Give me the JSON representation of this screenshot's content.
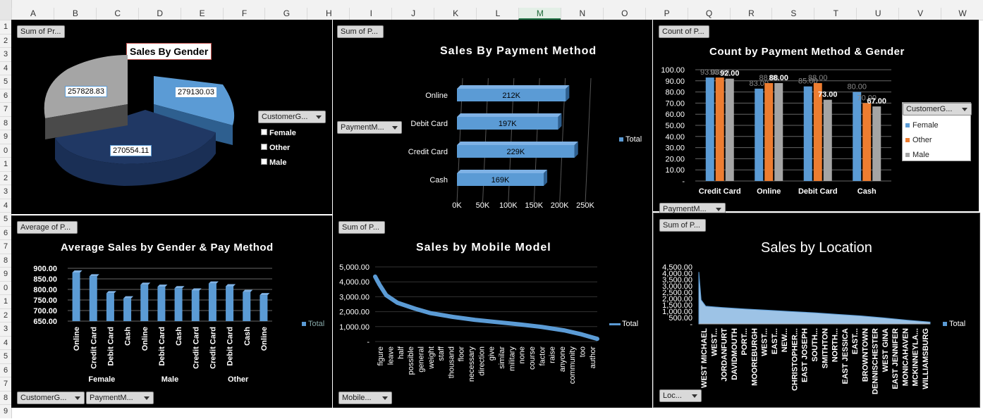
{
  "sheet": {
    "columns": [
      "A",
      "B",
      "C",
      "D",
      "E",
      "F",
      "G",
      "H",
      "I",
      "J",
      "K",
      "L",
      "M",
      "N",
      "O",
      "P",
      "Q",
      "R",
      "S",
      "T",
      "U",
      "V",
      "W"
    ],
    "selected_column": "M",
    "rows": [
      "1",
      "2",
      "3",
      "4",
      "5",
      "6",
      "7",
      "8",
      "9",
      "0",
      "1",
      "2",
      "3",
      "4",
      "5",
      "6",
      "7",
      "8",
      "9",
      "0",
      "1",
      "2",
      "3",
      "4",
      "5",
      "6",
      "7",
      "8",
      "9"
    ]
  },
  "panels": {
    "gender": {
      "title": "Sales By Gender",
      "field_button": "Sum of Pr...",
      "legend_button": "CustomerG...",
      "legend": [
        "Female",
        "Other",
        "Male"
      ],
      "colors": {
        "female": "#5b9bd5",
        "other": "#203864",
        "male": "#a5a5a5"
      }
    },
    "payment": {
      "title": "Sales By Payment Method",
      "field_button": "Sum of P...",
      "axis_button": "PaymentM...",
      "legend": "Total"
    },
    "count": {
      "title": "Count by Payment Method & Gender",
      "field_button": "Count of P...",
      "axis_button": "PaymentM...",
      "legend_button": "CustomerG...",
      "legend": [
        "Female",
        "Other",
        "Male"
      ]
    },
    "average": {
      "title": "Average Sales by Gender & Pay Method",
      "field_button": "Average of P...",
      "buttons": [
        "CustomerG...",
        "PaymentM..."
      ],
      "legend": "Total"
    },
    "mobile": {
      "title": "Sales by Mobile Model",
      "field_button": "Sum of P...",
      "axis_button": "Mobile...",
      "legend": "Total"
    },
    "location": {
      "title": "Sales by Location",
      "field_button": "Sum of P...",
      "axis_button": "Loc...",
      "legend": "Total"
    }
  },
  "chart_data": [
    {
      "type": "pie",
      "title": "Sales By Gender",
      "categories": [
        "Female",
        "Other",
        "Male"
      ],
      "values": [
        279130.03,
        270554.11,
        257828.83
      ],
      "value_labels": [
        "279130.03",
        "270554.11",
        "257828.83"
      ],
      "legend_placement": "right"
    },
    {
      "type": "bar",
      "orientation": "horizontal",
      "title": "Sales By Payment Method",
      "categories": [
        "Online",
        "Debit Card",
        "Credit Card",
        "Cash"
      ],
      "values": [
        212000,
        197000,
        229000,
        169000
      ],
      "value_labels": [
        "212K",
        "197K",
        "229K",
        "169K"
      ],
      "x_ticks": [
        "0K",
        "50K",
        "100K",
        "150K",
        "200K",
        "250K"
      ],
      "xlim": [
        0,
        250000
      ],
      "legend": [
        "Total"
      ],
      "legend_placement": "right"
    },
    {
      "type": "bar",
      "title": "Count by Payment Method & Gender",
      "categories": [
        "Credit Card",
        "Online",
        "Debit Card",
        "Cash"
      ],
      "series": [
        {
          "name": "Female",
          "values": [
            93,
            83,
            85,
            80
          ],
          "color": "#5b9bd5"
        },
        {
          "name": "Other",
          "values": [
            93,
            88,
            88,
            70
          ],
          "color": "#ed7d31"
        },
        {
          "name": "Male",
          "values": [
            92,
            88,
            73,
            67
          ],
          "color": "#a5a5a5"
        }
      ],
      "data_labels": [
        [
          "93.00",
          "83.00",
          "85.00",
          "80.00"
        ],
        [
          "93.00",
          "88.00",
          "88.00",
          "70.00"
        ],
        [
          "92.00",
          "88.00",
          "73.00",
          "67.00"
        ]
      ],
      "y_ticks": [
        "100.00",
        "90.00",
        "80.00",
        "70.00",
        "60.00",
        "50.00",
        "40.00",
        "30.00",
        "20.00",
        "10.00",
        "-"
      ],
      "ylim": [
        0,
        100
      ],
      "legend_placement": "right"
    },
    {
      "type": "bar",
      "title": "Average Sales by Gender & Pay Method",
      "groups": [
        "Female",
        "Male",
        "Other"
      ],
      "categories": [
        "Online",
        "Credit Card",
        "Debit Card",
        "Cash",
        "Online",
        "Debit Card",
        "Cash",
        "Credit Card",
        "Credit Card",
        "Debit Card",
        "Cash",
        "Online"
      ],
      "values": [
        880,
        862,
        782,
        758,
        822,
        813,
        806,
        795,
        828,
        815,
        788,
        773
      ],
      "y_ticks": [
        "900.00",
        "850.00",
        "800.00",
        "750.00",
        "700.00",
        "650.00"
      ],
      "ylim": [
        650,
        900
      ],
      "legend": [
        "Total"
      ],
      "legend_placement": "right"
    },
    {
      "type": "line",
      "title": "Sales by Mobile Model",
      "x_tick_labels": [
        "figure",
        "leave",
        "half",
        "possible",
        "general",
        "weight",
        "staff",
        "thousand",
        "floor",
        "necessary",
        "direction",
        "give",
        "similar",
        "military",
        "none",
        "course",
        "factor",
        "raise",
        "anyone",
        "community",
        "too",
        "author"
      ],
      "curve_points": [
        [
          0,
          4350
        ],
        [
          0.02,
          3800
        ],
        [
          0.05,
          3100
        ],
        [
          0.1,
          2600
        ],
        [
          0.18,
          2200
        ],
        [
          0.25,
          1900
        ],
        [
          0.35,
          1650
        ],
        [
          0.45,
          1450
        ],
        [
          0.55,
          1300
        ],
        [
          0.65,
          1150
        ],
        [
          0.75,
          980
        ],
        [
          0.85,
          750
        ],
        [
          0.93,
          480
        ],
        [
          1.0,
          180
        ]
      ],
      "y_ticks": [
        "5,000.00",
        "4,000.00",
        "3,000.00",
        "2,000.00",
        "1,000.00",
        "-"
      ],
      "ylim": [
        0,
        5000
      ],
      "legend": [
        "Total"
      ],
      "legend_placement": "right"
    },
    {
      "type": "area",
      "title": "Sales by Location",
      "x_tick_labels": [
        "WEST MICHAEL",
        "WEST...",
        "JORDANFURT",
        "DAVIDMOUTH",
        "PORT...",
        "MOOREBURGH",
        "WEST...",
        "EAST...",
        "NEW...",
        "CHRISTOPHER...",
        "EAST JOSEPH",
        "SOUTH...",
        "SMITHTON",
        "NORTH...",
        "EAST JESSICA",
        "EAST...",
        "BROWNTOWN",
        "DENNISCHESTER",
        "WEST GINA",
        "EAST JENNIFER",
        "MONICAHAVEN",
        "MCKINNEYLA...",
        "WILLIAMSBURG"
      ],
      "curve_points": [
        [
          0,
          4100
        ],
        [
          0.01,
          1900
        ],
        [
          0.03,
          1400
        ],
        [
          0.1,
          1300
        ],
        [
          0.2,
          1180
        ],
        [
          0.3,
          1080
        ],
        [
          0.4,
          980
        ],
        [
          0.5,
          880
        ],
        [
          0.6,
          760
        ],
        [
          0.7,
          640
        ],
        [
          0.8,
          480
        ],
        [
          0.9,
          300
        ],
        [
          1.0,
          150
        ]
      ],
      "y_ticks": [
        "4,500.00",
        "4,000.00",
        "3,500.00",
        "3,000.00",
        "2,500.00",
        "2,000.00",
        "1,500.00",
        "1,000.00",
        "500.00",
        "-"
      ],
      "ylim": [
        0,
        4500
      ],
      "legend": [
        "Total"
      ],
      "legend_placement": "right"
    }
  ]
}
